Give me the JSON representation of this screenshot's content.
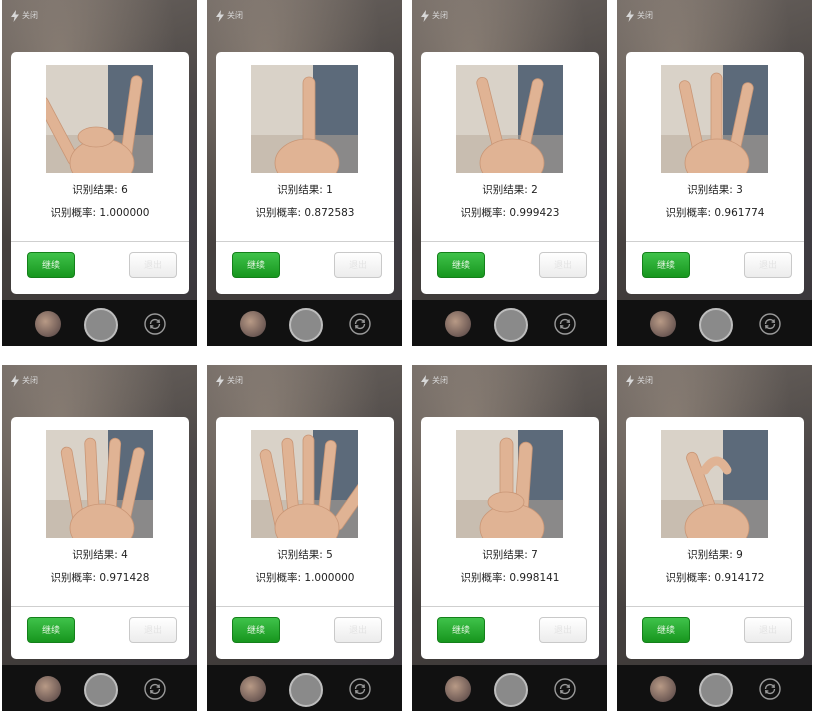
{
  "labels": {
    "close": "关闭",
    "result_prefix": "识别结果: ",
    "prob_prefix": "识别概率: ",
    "continue": "继续",
    "exit": "退出"
  },
  "screens": [
    {
      "result": "6",
      "probability": "1.000000",
      "gesture": 6
    },
    {
      "result": "1",
      "probability": "0.872583",
      "gesture": 1
    },
    {
      "result": "2",
      "probability": "0.999423",
      "gesture": 2
    },
    {
      "result": "3",
      "probability": "0.961774",
      "gesture": 3
    },
    {
      "result": "4",
      "probability": "0.971428",
      "gesture": 4
    },
    {
      "result": "5",
      "probability": "1.000000",
      "gesture": 5
    },
    {
      "result": "7",
      "probability": "0.998141",
      "gesture": 7
    },
    {
      "result": "9",
      "probability": "0.914172",
      "gesture": 9
    }
  ],
  "colors": {
    "continue_button": "#2aa834",
    "exit_button": "#f4f4f4",
    "dialog": "#ffffff",
    "bottom_bar": "#111111"
  },
  "icons": [
    "flash-icon",
    "gallery-thumbnail",
    "shutter-button",
    "switch-camera-icon"
  ]
}
